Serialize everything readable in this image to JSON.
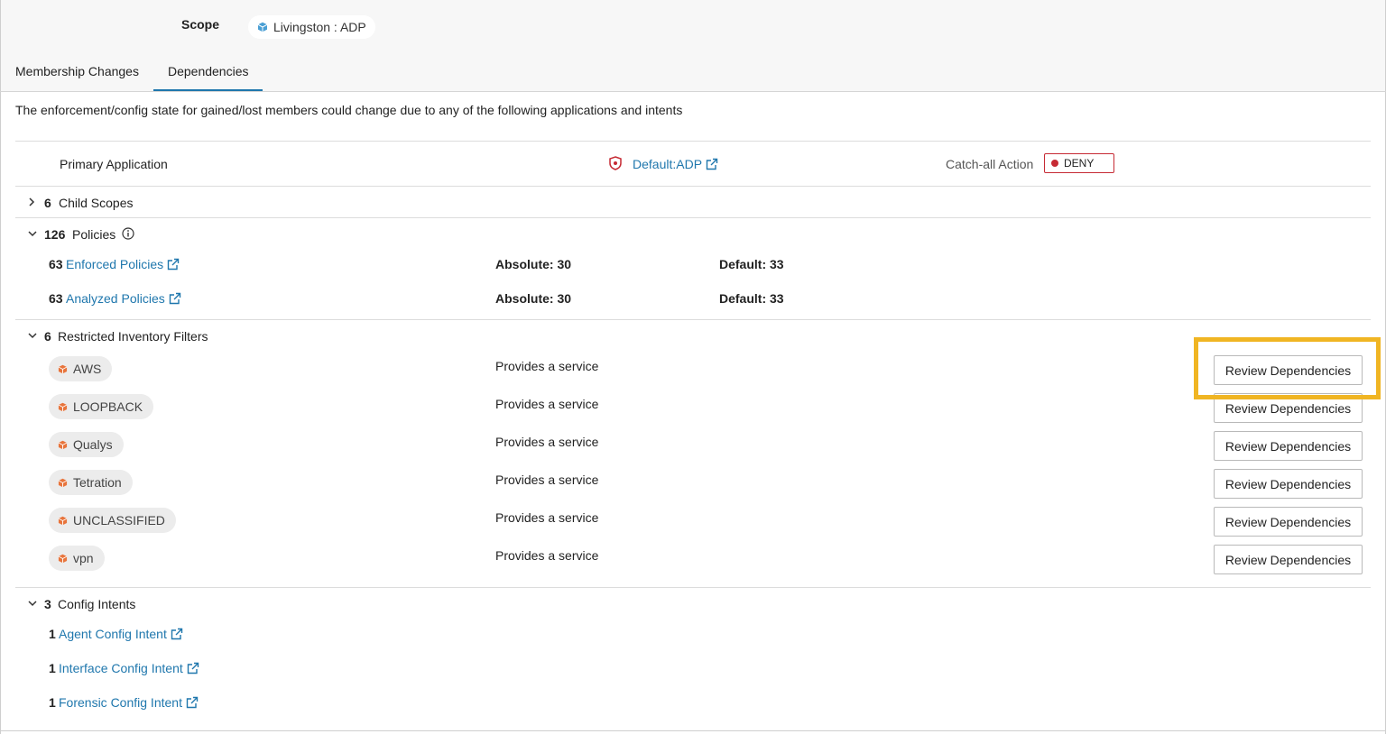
{
  "header": {
    "scope_label": "Scope",
    "scope_value": "Livingston : ADP"
  },
  "tabs": [
    {
      "label": "Membership Changes",
      "active": false
    },
    {
      "label": "Dependencies",
      "active": true
    }
  ],
  "description": "The enforcement/config state for gained/lost members could change due to any of the following applications and intents",
  "primary_application": {
    "label": "Primary Application",
    "app_link": "Default:ADP",
    "catch_all_label": "Catch-all Action",
    "catch_all_value": "DENY"
  },
  "child_scopes": {
    "count": "6",
    "label": "Child Scopes",
    "expanded": false
  },
  "policies": {
    "count": "126",
    "label": "Policies",
    "rows": [
      {
        "count": "63",
        "link": "Enforced Policies",
        "absolute": "Absolute: 30",
        "default": "Default: 33"
      },
      {
        "count": "63",
        "link": "Analyzed Policies",
        "absolute": "Absolute: 30",
        "default": "Default: 33"
      }
    ]
  },
  "filters": {
    "count": "6",
    "label": "Restricted Inventory Filters",
    "items": [
      {
        "name": "AWS",
        "relation": "Provides a service",
        "button": "Review Dependencies"
      },
      {
        "name": "LOOPBACK",
        "relation": "Provides a service",
        "button": "Review Dependencies"
      },
      {
        "name": "Qualys",
        "relation": "Provides a service",
        "button": "Review Dependencies"
      },
      {
        "name": "Tetration",
        "relation": "Provides a service",
        "button": "Review Dependencies"
      },
      {
        "name": "UNCLASSIFIED",
        "relation": "Provides a service",
        "button": "Review Dependencies"
      },
      {
        "name": "vpn",
        "relation": "Provides a service",
        "button": "Review Dependencies"
      }
    ]
  },
  "config_intents": {
    "count": "3",
    "label": "Config Intents",
    "items": [
      {
        "count": "1",
        "link": "Agent Config Intent"
      },
      {
        "count": "1",
        "link": "Interface Config Intent"
      },
      {
        "count": "1",
        "link": "Forensic Config Intent"
      }
    ]
  },
  "colors": {
    "link": "#1f77ad",
    "deny": "#c62a34",
    "highlight": "#f0b523",
    "filter_icon": "#e8743b"
  },
  "icons": {
    "scope": "cube-icon",
    "app": "shield-icon",
    "external": "external-link-icon",
    "info": "info-icon",
    "filter": "cube-icon"
  }
}
